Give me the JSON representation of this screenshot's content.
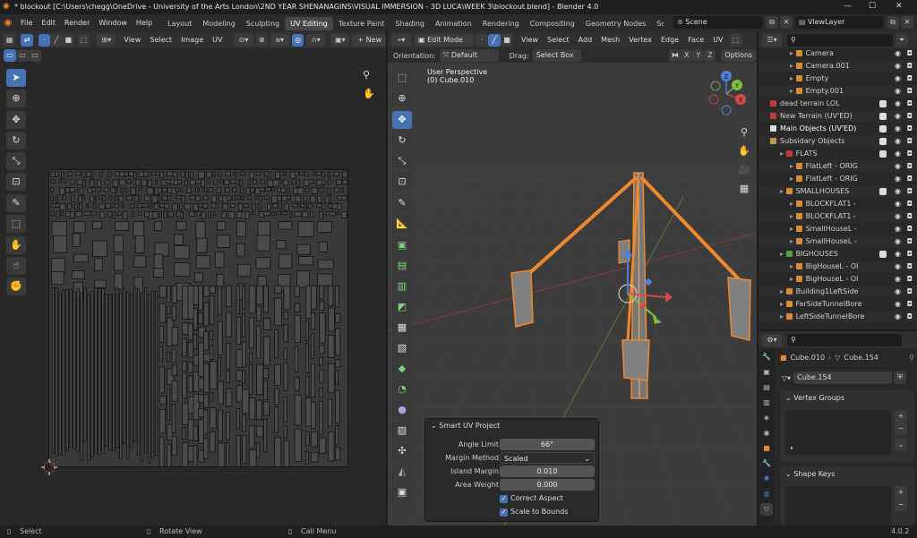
{
  "window": {
    "title": "* blockout [C:\\Users\\chegg\\OneDrive - University of the Arts London\\2ND YEAR SHENANAGINS\\VISUAL IMMERSION - 3D LUCA\\WEEK 3\\blockout.blend] - Blender 4.0",
    "minimize": "—",
    "maximize": "☐",
    "close": "✕"
  },
  "menu": [
    "File",
    "Edit",
    "Render",
    "Window",
    "Help"
  ],
  "workspaces": [
    "Layout",
    "Modeling",
    "Sculpting",
    "UV Editing",
    "Texture Paint",
    "Shading",
    "Animation",
    "Rendering",
    "Compositing",
    "Geometry Nodes",
    "Scriptin"
  ],
  "active_workspace": "UV Editing",
  "scene": "Scene",
  "view_layer": "ViewLayer",
  "uv_editor": {
    "menus": [
      "View",
      "Select",
      "Image",
      "UV"
    ],
    "new_button": "+ New"
  },
  "viewport": {
    "mode": "Edit Mode",
    "menus": [
      "View",
      "Select",
      "Add",
      "Mesh",
      "Vertex",
      "Edge",
      "Face",
      "UV"
    ],
    "orientation_label": "Orientation:",
    "orientation_value": "Default",
    "drag_label": "Drag:",
    "drag_value": "Select Box",
    "axes": [
      "X",
      "Y",
      "Z"
    ],
    "options": "Options",
    "overlay_line1": "User Perspective",
    "overlay_line2": "(0) Cube.010"
  },
  "outliner": {
    "rows": [
      {
        "name": "Camera",
        "indent": 3,
        "color": "#d88c3a",
        "checkbox": false
      },
      {
        "name": "Camera.001",
        "indent": 3,
        "color": "#d88c3a",
        "checkbox": false
      },
      {
        "name": "Empty",
        "indent": 3,
        "color": "#d88c3a",
        "checkbox": false
      },
      {
        "name": "Empty.001",
        "indent": 3,
        "color": "#d88c3a",
        "checkbox": false
      },
      {
        "name": "dead terrain LOL",
        "indent": 1,
        "color": "#c23b3b",
        "checkbox": true
      },
      {
        "name": "New Terrain (UV'ED)",
        "indent": 1,
        "color": "#c23b3b",
        "checkbox": true
      },
      {
        "name": "Main Objects (UV'ED)",
        "indent": 1,
        "color": "#dddddd",
        "checkbox": true
      },
      {
        "name": "Subsidary Objects",
        "indent": 1,
        "color": "#b89a4a",
        "checkbox": true
      },
      {
        "name": "FLATS",
        "indent": 2,
        "color": "#c23b3b",
        "checkbox": true
      },
      {
        "name": "FlatLeft - ORIG",
        "indent": 3,
        "color": "#d88c3a",
        "checkbox": false
      },
      {
        "name": "FlatLeft - ORIG",
        "indent": 3,
        "color": "#d88c3a",
        "checkbox": false
      },
      {
        "name": "SMALLHOUSES",
        "indent": 2,
        "color": "#d88c3a",
        "checkbox": true
      },
      {
        "name": "BLOCKFLAT1 -",
        "indent": 3,
        "color": "#d88c3a",
        "checkbox": false
      },
      {
        "name": "BLOCKFLAT1 -",
        "indent": 3,
        "color": "#d88c3a",
        "checkbox": false
      },
      {
        "name": "SmallHouseL -",
        "indent": 3,
        "color": "#d88c3a",
        "checkbox": false
      },
      {
        "name": "SmallHouseL -",
        "indent": 3,
        "color": "#d88c3a",
        "checkbox": false
      },
      {
        "name": "BIGHOUSES",
        "indent": 2,
        "color": "#5aa04a",
        "checkbox": true
      },
      {
        "name": "BigHouseL - OI",
        "indent": 3,
        "color": "#d88c3a",
        "checkbox": false
      },
      {
        "name": "BigHouseL - OI",
        "indent": 3,
        "color": "#d88c3a",
        "checkbox": false
      },
      {
        "name": "Building1LeftSide",
        "indent": 2,
        "color": "#d88c3a",
        "checkbox": false
      },
      {
        "name": "FarSideTunnelBore",
        "indent": 2,
        "color": "#d88c3a",
        "checkbox": false
      },
      {
        "name": "LeftSideTunnelBore",
        "indent": 2,
        "color": "#d88c3a",
        "checkbox": false
      }
    ]
  },
  "properties": {
    "breadcrumb_object": "Cube.010",
    "breadcrumb_mesh": "Cube.154",
    "mesh_name": "Cube.154",
    "vertex_groups": "Vertex Groups",
    "shape_keys": "Shape Keys"
  },
  "operator": {
    "title": "Smart UV Project",
    "fields": [
      {
        "label": "Angle Limit",
        "value": "66°"
      },
      {
        "label": "Margin Method",
        "value": "Scaled"
      },
      {
        "label": "Island Margin",
        "value": "0.010"
      },
      {
        "label": "Area Weight",
        "value": "0.000"
      }
    ],
    "checks": [
      "Correct Aspect",
      "Scale to Bounds"
    ]
  },
  "status": {
    "select": "Select",
    "rotate": "Rotate View",
    "menu": "Call Menu",
    "version": "4.0.2"
  },
  "colors": {
    "accent": "#4772b3",
    "selection_orange": "#f0892e",
    "outliner_active": "#334d80"
  }
}
